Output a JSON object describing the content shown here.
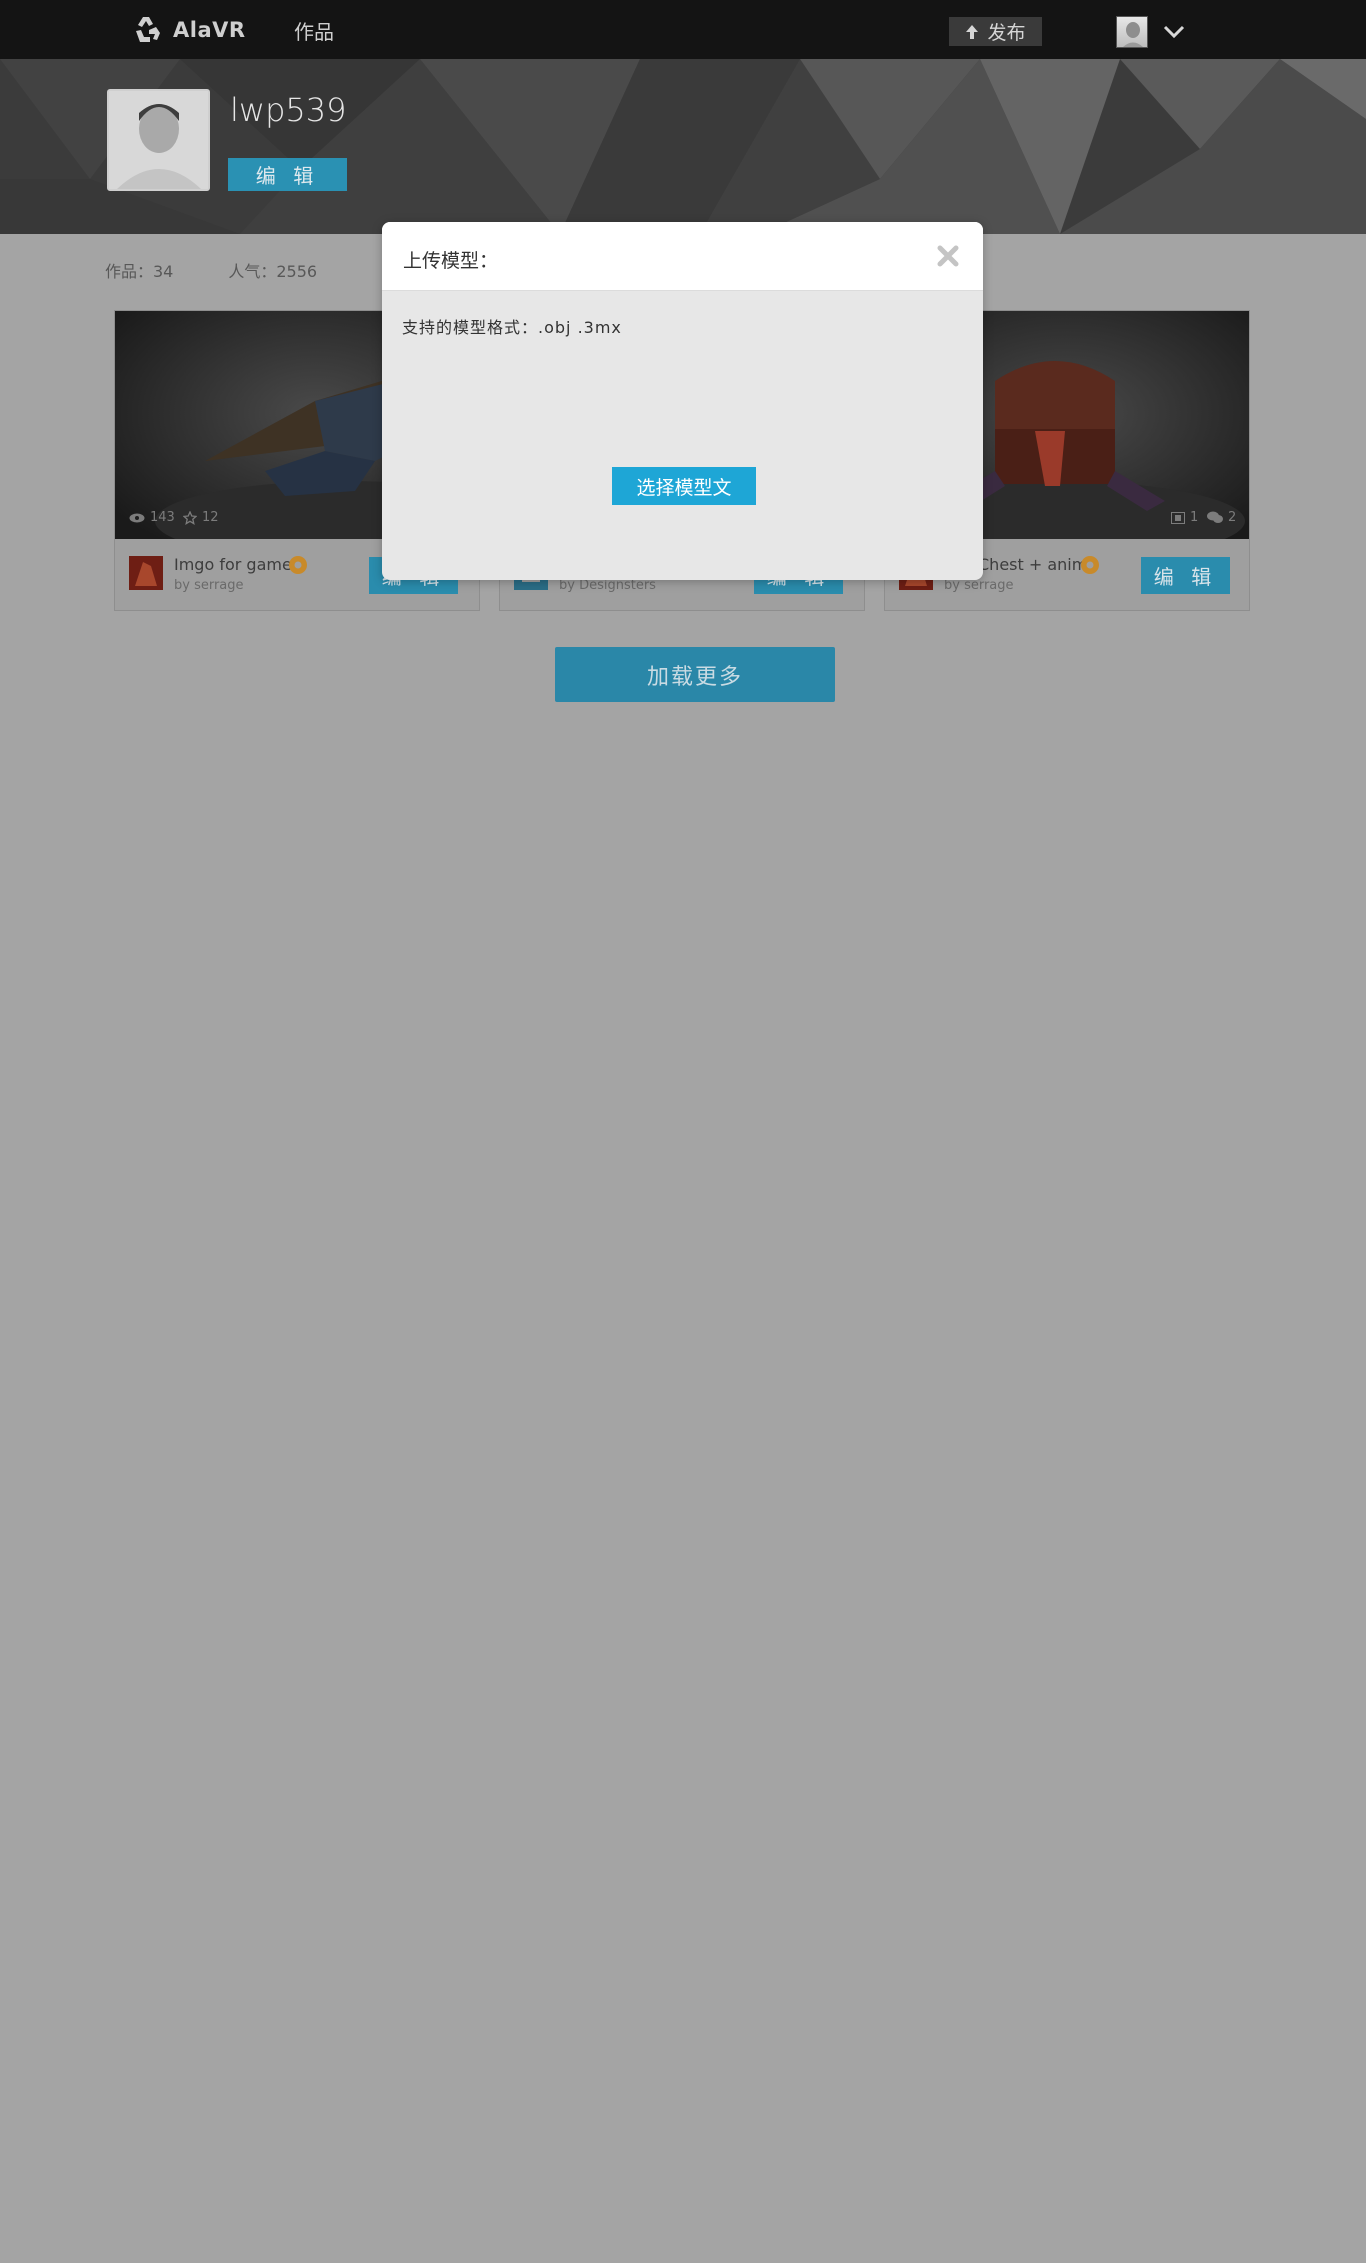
{
  "nav": {
    "brand": "AlaVR",
    "works_label": "作品",
    "publish_label": "发布"
  },
  "profile": {
    "username": "lwp539",
    "edit_label": "编 辑"
  },
  "stats": {
    "works": "作品：34",
    "popularity": "人气：2556"
  },
  "cards": [
    {
      "title": "Imgo for game",
      "author": "by serrage",
      "views": "143",
      "stars": "12",
      "edit_label": "编 辑"
    },
    {
      "title": "",
      "author": "by Designsters",
      "edit_label": "编 辑"
    },
    {
      "title": "Chest + anim",
      "author": "by serrage",
      "models": "1",
      "comments": "2",
      "edit_label": "编 辑"
    }
  ],
  "load_more_label": "加载更多",
  "modal": {
    "title": "上传模型：",
    "formats": "支持的模型格式：.obj  .3mx",
    "select_label": "选择模型文"
  },
  "colors": {
    "accent": "#1ea6d6",
    "badge": "#e8a030",
    "topbar": "#141414",
    "overlay_bg": "#a4a4a4"
  },
  "icons": {
    "logo": "recycle-logo-icon",
    "publish": "upload-arrow-icon",
    "chevron": "chevron-down-icon",
    "close": "close-x-icon",
    "views": "eye-icon",
    "stars": "star-icon",
    "badge": "gear-badge-icon",
    "models": "film-icon",
    "comments": "comments-icon"
  }
}
